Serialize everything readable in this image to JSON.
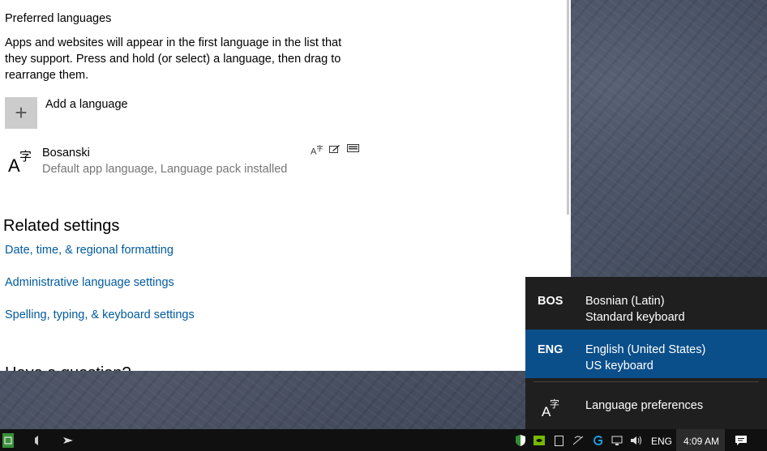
{
  "settings": {
    "preferred_heading": "Preferred languages",
    "preferred_desc": "Apps and websites will appear in the first language in the list that they support. Press and hold (or select) a language, then drag to rearrange them.",
    "add_language": "Add a language",
    "language": {
      "name": "Bosanski",
      "status": "Default app language, Language pack installed",
      "icon": "language-icon"
    },
    "feature_icons": [
      "text-to-speech-icon",
      "handwriting-icon",
      "keyboard-icon"
    ],
    "related_heading": "Related settings",
    "links": [
      "Date, time, & regional formatting",
      "Administrative language settings",
      "Spelling, typing, & keyboard settings"
    ],
    "cut_heading": "Have a question?"
  },
  "flyout": {
    "items": [
      {
        "code": "BOS",
        "language": "Bosnian (Latin)",
        "keyboard": "Standard keyboard",
        "selected": false
      },
      {
        "code": "ENG",
        "language": "English (United States)",
        "keyboard": "US keyboard",
        "selected": true
      }
    ],
    "preferences": "Language preferences",
    "selected_color": "#0b4f8a"
  },
  "taskbar": {
    "input_indicator": "ENG",
    "clock": "4:09 AM"
  }
}
